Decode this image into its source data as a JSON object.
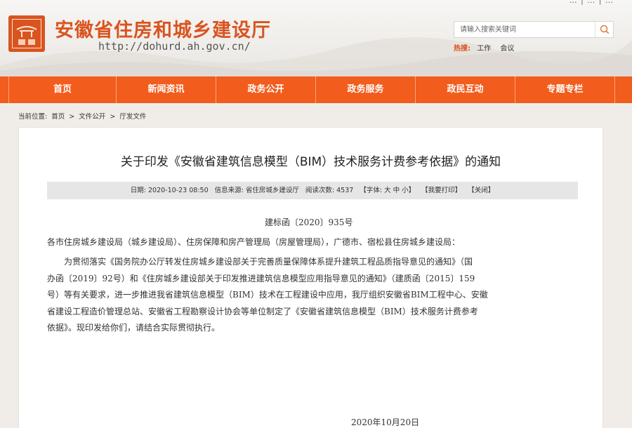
{
  "header": {
    "top_links": "… | … | …",
    "site_title": "安徽省住房和城乡建设厅",
    "site_url": "http://dohurd.ah.gov.cn/",
    "search": {
      "placeholder": "请输入搜索关键词"
    },
    "hot": {
      "label": "热搜:",
      "items": [
        "工作",
        "会议"
      ]
    }
  },
  "nav": {
    "items": [
      "首页",
      "新闻资讯",
      "政务公开",
      "政务服务",
      "政民互动",
      "专题专栏"
    ]
  },
  "breadcrumb": {
    "label": "当前位置:",
    "items": [
      "首页",
      "文件公开",
      "厅发文件"
    ],
    "separator": ">"
  },
  "article": {
    "title": "关于印发《安徽省建筑信息模型（BIM）技术服务计费参考依据》的通知",
    "meta": {
      "date": "日期: 2020-10-23 08:50",
      "source": "信息来源: 省住房城乡建设厅",
      "views": "阅读次数: 4537",
      "font": "【字体: 大 中 小】",
      "print": "【我要打印】",
      "close": "【关闭】"
    },
    "doc_number": "建标函〔2020〕935号",
    "addressee": "各市住房城乡建设局（城乡建设局）、住房保障和房产管理局（房屋管理局），广德市、宿松县住房城乡建设局：",
    "body_lines": [
      "　　为贯彻落实《国务院办公厅转发住房城乡建设部关于完善质量保障体系提升建筑工程品质指导意见的通知》（国",
      "办函〔2019〕92号）和《住房城乡建设部关于印发推进建筑信息模型应用指导意见的通知》（建质函〔2015〕159",
      "号）等有关要求，进一步推进我省建筑信息模型（BIM）技术在工程建设中应用，我厅组织安徽省BIM工程中心、安徽",
      "省建设工程造价管理总站、安徽省工程勘察设计协会等单位制定了《安徽省建筑信息模型（BIM）技术服务计费参考",
      "依据》。现印发给你们，请结合实际贯彻执行。"
    ],
    "sign_date": "2020年10月20日"
  },
  "colors": {
    "brand": "#d9541f",
    "nav_bg": "#f25c1c",
    "page_bg": "#f0ede8",
    "meta_bg": "#e6e6e6"
  },
  "icons": {
    "logo": "emblem-logo-icon",
    "search": "search-icon"
  }
}
